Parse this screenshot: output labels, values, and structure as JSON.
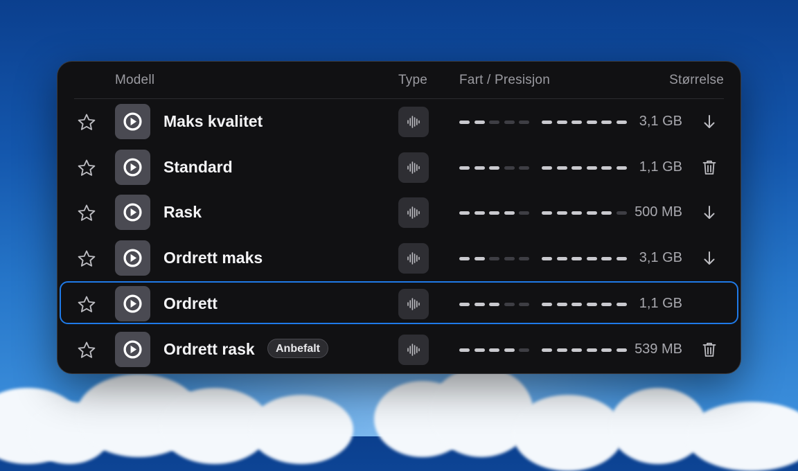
{
  "colors": {
    "panel_bg": "#111113",
    "accent": "#1f7ae8",
    "bar_on": "#c9c9ce",
    "bar_off": "#3e3e44"
  },
  "header": {
    "model": "Modell",
    "type": "Type",
    "speed_precision": "Fart / Presisjon",
    "size": "Størrelse"
  },
  "models": [
    {
      "name": "Maks kvalitet",
      "badge": "",
      "size": "3,1 GB",
      "speed": 2,
      "precision": 6,
      "action": "download-icon",
      "selected": false
    },
    {
      "name": "Standard",
      "badge": "",
      "size": "1,1 GB",
      "speed": 3,
      "precision": 6,
      "action": "trash-icon",
      "selected": false
    },
    {
      "name": "Rask",
      "badge": "",
      "size": "500 MB",
      "speed": 4,
      "precision": 5,
      "action": "download-icon",
      "selected": false
    },
    {
      "name": "Ordrett maks",
      "badge": "",
      "size": "3,1 GB",
      "speed": 2,
      "precision": 6,
      "action": "download-icon",
      "selected": false
    },
    {
      "name": "Ordrett",
      "badge": "",
      "size": "1,1 GB",
      "speed": 3,
      "precision": 6,
      "action": "",
      "selected": true
    },
    {
      "name": "Ordrett rask",
      "badge": "Anbefalt",
      "size": "539 MB",
      "speed": 4,
      "precision": 6,
      "action": "trash-icon",
      "selected": false
    }
  ]
}
